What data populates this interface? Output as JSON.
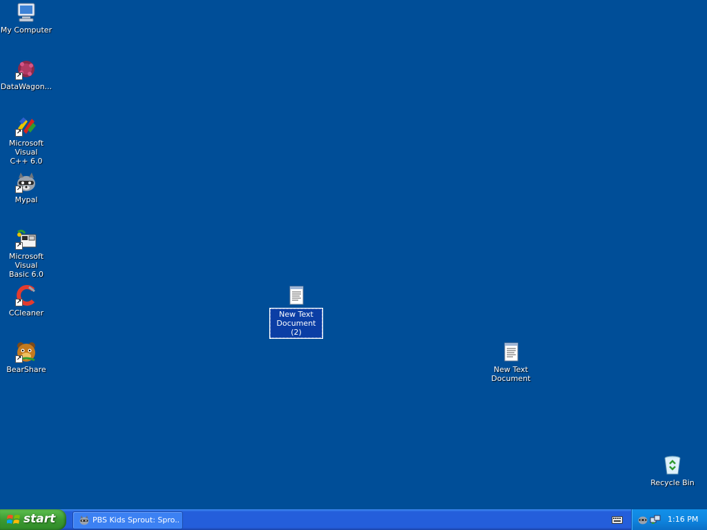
{
  "desktop": {
    "background_color": "#004e98",
    "icons": [
      {
        "label": "My Computer",
        "icon": "computer-icon",
        "shortcut": false
      },
      {
        "label": "DataWagon...",
        "icon": "datawagon-icon",
        "shortcut": true
      },
      {
        "label": "Microsoft Visual\nC++ 6.0",
        "icon": "visual-cpp-icon",
        "shortcut": true
      },
      {
        "label": "Mypal",
        "icon": "mypal-raccoon-icon",
        "shortcut": true
      },
      {
        "label": "Microsoft Visual\nBasic 6.0",
        "icon": "visual-basic-icon",
        "shortcut": true
      },
      {
        "label": "CCleaner",
        "icon": "ccleaner-icon",
        "shortcut": true
      },
      {
        "label": "BearShare",
        "icon": "bearshare-icon",
        "shortcut": true
      },
      {
        "label": "New Text\nDocument (2)",
        "icon": "text-document-icon",
        "shortcut": false,
        "selected": true
      },
      {
        "label": "New Text\nDocument",
        "icon": "text-document-icon",
        "shortcut": false
      },
      {
        "label": "Recycle Bin",
        "icon": "recycle-bin-icon",
        "shortcut": false
      }
    ]
  },
  "taskbar": {
    "start_label": "start",
    "task_button": {
      "label": "PBS Kids Sprout: Spro...",
      "icon": "mypal-raccoon-icon"
    },
    "language_icon": "keyboard-icon",
    "tray": {
      "icons": [
        "mypal-raccoon-icon",
        "network-icon"
      ],
      "clock": "1:16 PM"
    },
    "colors": {
      "start": "#3c9a32",
      "bar": "#245edb",
      "tray": "#0f86e0"
    }
  }
}
